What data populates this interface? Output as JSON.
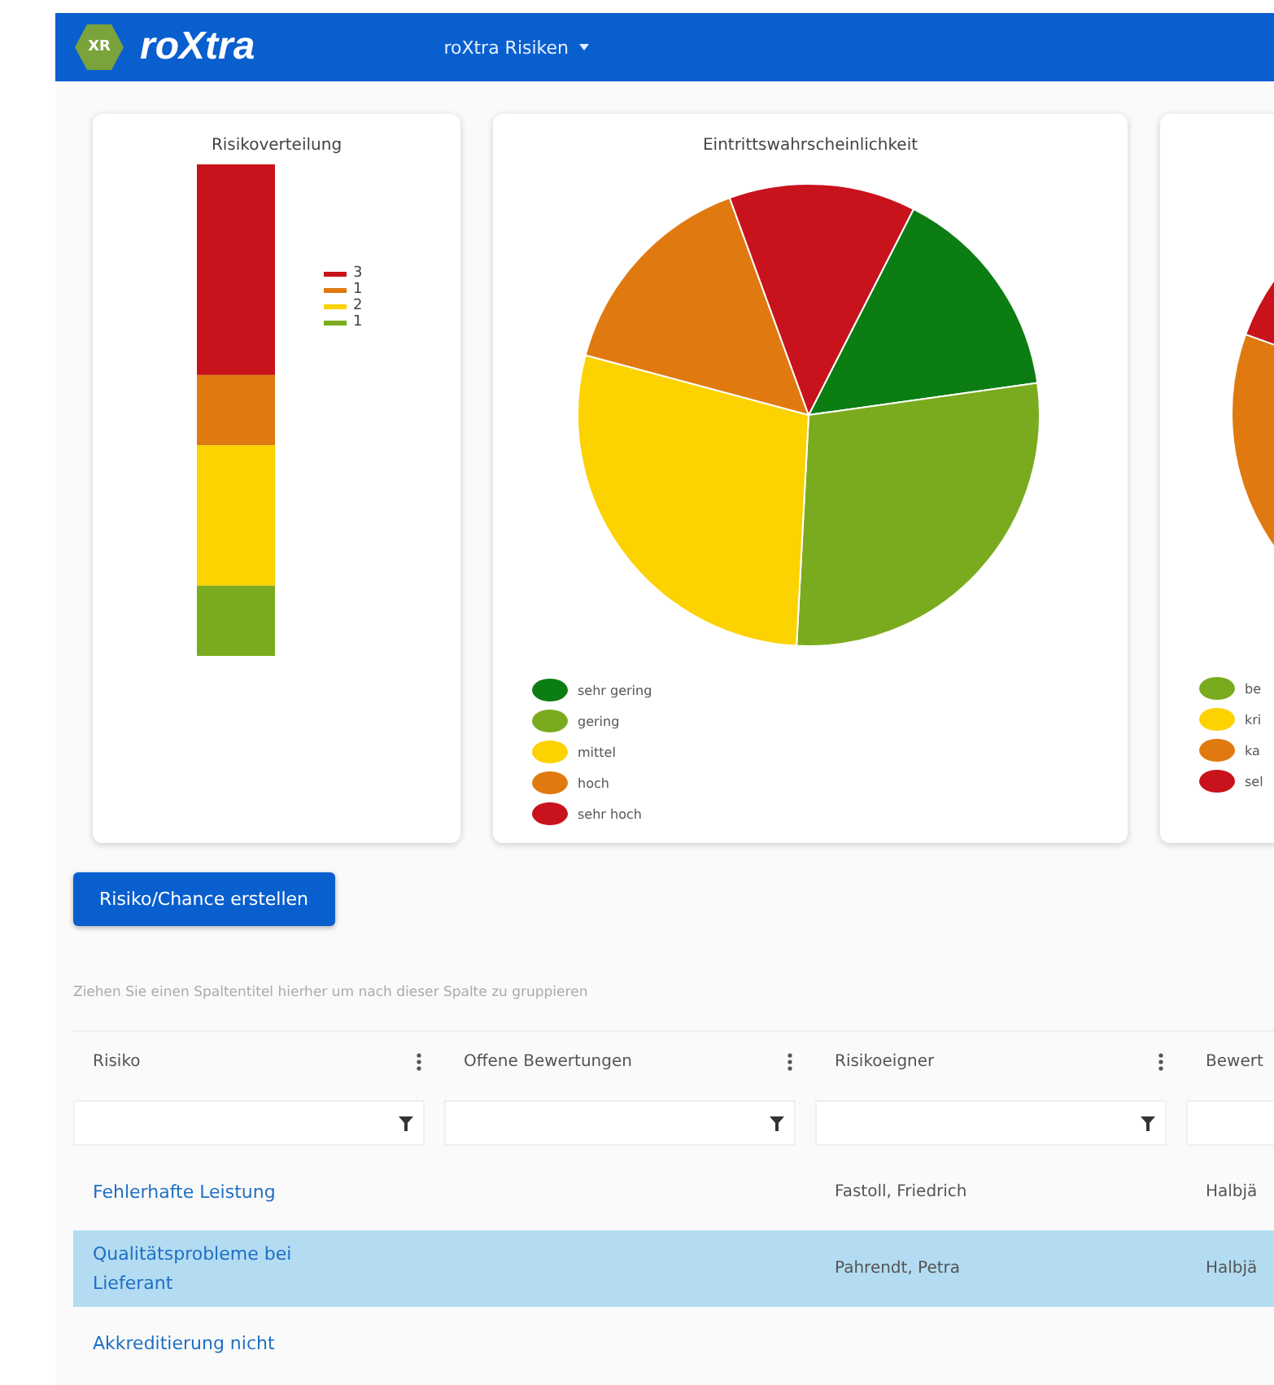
{
  "header": {
    "logo_badge": "XR",
    "brand": "roXtra",
    "app_menu": "roXtra Risiken"
  },
  "cards": [
    {
      "kind": "stacked",
      "title": "Risikoverteilung",
      "legend": [
        {
          "label": "3",
          "color": "#c8121c"
        },
        {
          "label": "1",
          "color": "#e07a10"
        },
        {
          "label": "2",
          "color": "#fcd200"
        },
        {
          "label": "1",
          "color": "#7aab1e"
        }
      ]
    },
    {
      "kind": "pie",
      "title": "Eintrittswahrscheinlichkeit",
      "legend": [
        {
          "label": "sehr gering",
          "color": "#0b7d12"
        },
        {
          "label": "gering",
          "color": "#7aab1e"
        },
        {
          "label": "mittel",
          "color": "#fcd200"
        },
        {
          "label": "hoch",
          "color": "#e07a10"
        },
        {
          "label": "sehr hoch",
          "color": "#c8121c"
        }
      ]
    },
    {
      "kind": "pie_cut",
      "legend": [
        {
          "label": "be",
          "color": "#7aab1e"
        },
        {
          "label": "kri",
          "color": "#fcd200"
        },
        {
          "label": "ka",
          "color": "#e07a10"
        },
        {
          "label": "sel",
          "color": "#c8121c"
        }
      ]
    }
  ],
  "create_button": "Risiko/Chance erstellen",
  "group_hint": "Ziehen Sie einen Spaltentitel hierher um nach dieser Spalte zu gruppieren",
  "table": {
    "columns": [
      "Risiko",
      "Offene Bewertungen",
      "Risikoeigner",
      "Bewert"
    ],
    "rows": [
      {
        "selected": false,
        "cells": [
          "Fehlerhafte Leistung",
          "",
          "Fastoll, Friedrich",
          "Halbjä"
        ]
      },
      {
        "selected": true,
        "cells": [
          "Qualitätsprobleme bei Lieferant",
          "",
          "Pahrendt, Petra",
          "Halbjä"
        ]
      },
      {
        "selected": false,
        "cells": [
          "Akkreditierung nicht",
          "",
          "",
          ""
        ]
      }
    ]
  }
}
